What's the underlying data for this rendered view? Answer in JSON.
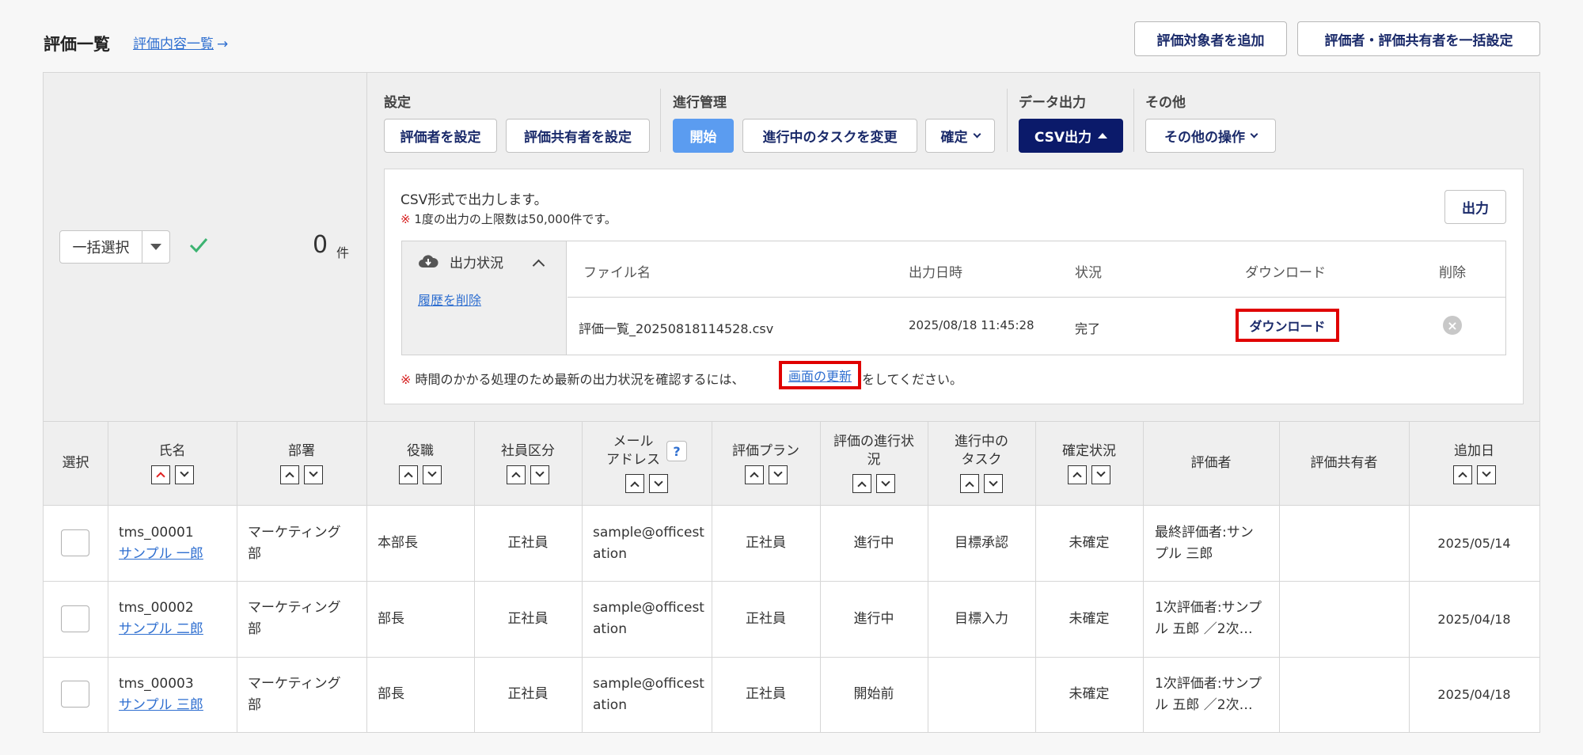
{
  "header": {
    "title": "評価一覧",
    "content_link": "評価内容一覧",
    "add_target_button": "評価対象者を追加",
    "bulk_set_button": "評価者・評価共有者を一括設定"
  },
  "selection": {
    "bulk_select_label": "一括選択",
    "count": "0",
    "count_unit": "件"
  },
  "actions": {
    "settings": {
      "label": "設定",
      "set_evaluator": "評価者を設定",
      "set_sharer": "評価共有者を設定"
    },
    "progress": {
      "label": "進行管理",
      "start": "開始",
      "change_task": "進行中のタスクを変更",
      "confirm": "確定"
    },
    "export": {
      "label": "データ出力",
      "csv": "CSV出力"
    },
    "other": {
      "label": "その他",
      "other_ops": "その他の操作"
    }
  },
  "csv_panel": {
    "description": "CSV形式で出力します。",
    "note_mark": "※",
    "note": "1度の出力の上限数は50,000件です。",
    "output_button": "出力",
    "status_title": "出力状況",
    "delete_history": "履歴を削除",
    "columns": {
      "file_name": "ファイル名",
      "output_time": "出力日時",
      "status": "状況",
      "download": "ダウンロード",
      "delete": "削除"
    },
    "row": {
      "file_name": "評価一覧_20250818114528.csv",
      "output_time": "2025/08/18 11:45:28",
      "status": "完了",
      "download_button": "ダウンロード"
    },
    "time_note_mark": "※",
    "time_note_before": "時間のかかる処理のため最新の出力状況を確認するには、",
    "refresh_link": "画面の更新",
    "time_note_after": "をしてください。"
  },
  "table": {
    "headers": {
      "select": "選択",
      "name": "氏名",
      "dept": "部署",
      "position": "役職",
      "emp_type": "社員区分",
      "email_1": "メール",
      "email_2": "アドレス",
      "plan": "評価プラン",
      "progress_1": "評価の進行状",
      "progress_2": "況",
      "task_1": "進行中の",
      "task_2": "タスク",
      "confirm_status": "確定状況",
      "evaluator": "評価者",
      "sharer": "評価共有者",
      "added": "追加日"
    },
    "rows": [
      {
        "id": "tms_00001",
        "name": "サンプル 一郎",
        "dept_1": "マーケティング",
        "dept_2": "部",
        "position": "本部長",
        "emp_type": "正社員",
        "email_1": "sample@officest",
        "email_2": "ation",
        "plan": "正社員",
        "progress": "進行中",
        "task": "目標承認",
        "confirm": "未確定",
        "evaluator_1": "最終評価者:サン",
        "evaluator_2": "プル 三郎",
        "added": "2025/05/14"
      },
      {
        "id": "tms_00002",
        "name": "サンプル 二郎",
        "dept_1": "マーケティング",
        "dept_2": "部",
        "position": "部長",
        "emp_type": "正社員",
        "email_1": "sample@officest",
        "email_2": "ation",
        "plan": "正社員",
        "progress": "進行中",
        "task": "目標入力",
        "confirm": "未確定",
        "evaluator_1": "1次評価者:サンプ",
        "evaluator_2": "ル 五郎 ／2次…",
        "added": "2025/04/18"
      },
      {
        "id": "tms_00003",
        "name": "サンプル 三郎",
        "dept_1": "マーケティング",
        "dept_2": "部",
        "position": "部長",
        "emp_type": "正社員",
        "email_1": "sample@officest",
        "email_2": "ation",
        "plan": "正社員",
        "progress": "開始前",
        "task": "",
        "confirm": "未確定",
        "evaluator_1": "1次評価者:サンプ",
        "evaluator_2": "ル 五郎 ／2次…",
        "added": "2025/04/18"
      }
    ]
  }
}
